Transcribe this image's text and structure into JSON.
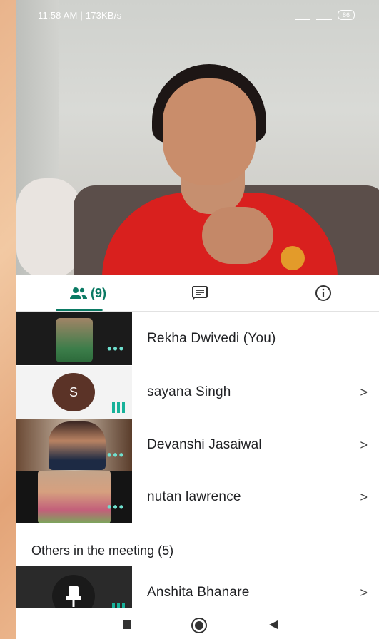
{
  "status_bar": {
    "left_text": "11:58 AM | 173KB/s",
    "battery": "86"
  },
  "tabs": {
    "people_count": "(9)"
  },
  "participants": [
    {
      "name": "Rekha Dwivedi (You)",
      "has_chevron": false,
      "indicator": "dots"
    },
    {
      "name": "sayana Singh",
      "has_chevron": true,
      "indicator": "bars",
      "avatar_letter": "S"
    },
    {
      "name": "Devanshi Jasaiwal",
      "has_chevron": true,
      "indicator": "dots"
    },
    {
      "name": "nutan lawrence",
      "has_chevron": true,
      "indicator": "dots"
    }
  ],
  "others_section": {
    "title": "Others in the meeting (5)",
    "participants": [
      {
        "name": "Anshita Bhanare",
        "has_chevron": true,
        "indicator": "bars"
      }
    ]
  },
  "chevron_glyph": ">",
  "dots_glyph": "•••",
  "colors": {
    "accent": "#0b7a64",
    "speaking_indicator": "#17b29a",
    "dots_indicator": "#6fe0cf"
  }
}
